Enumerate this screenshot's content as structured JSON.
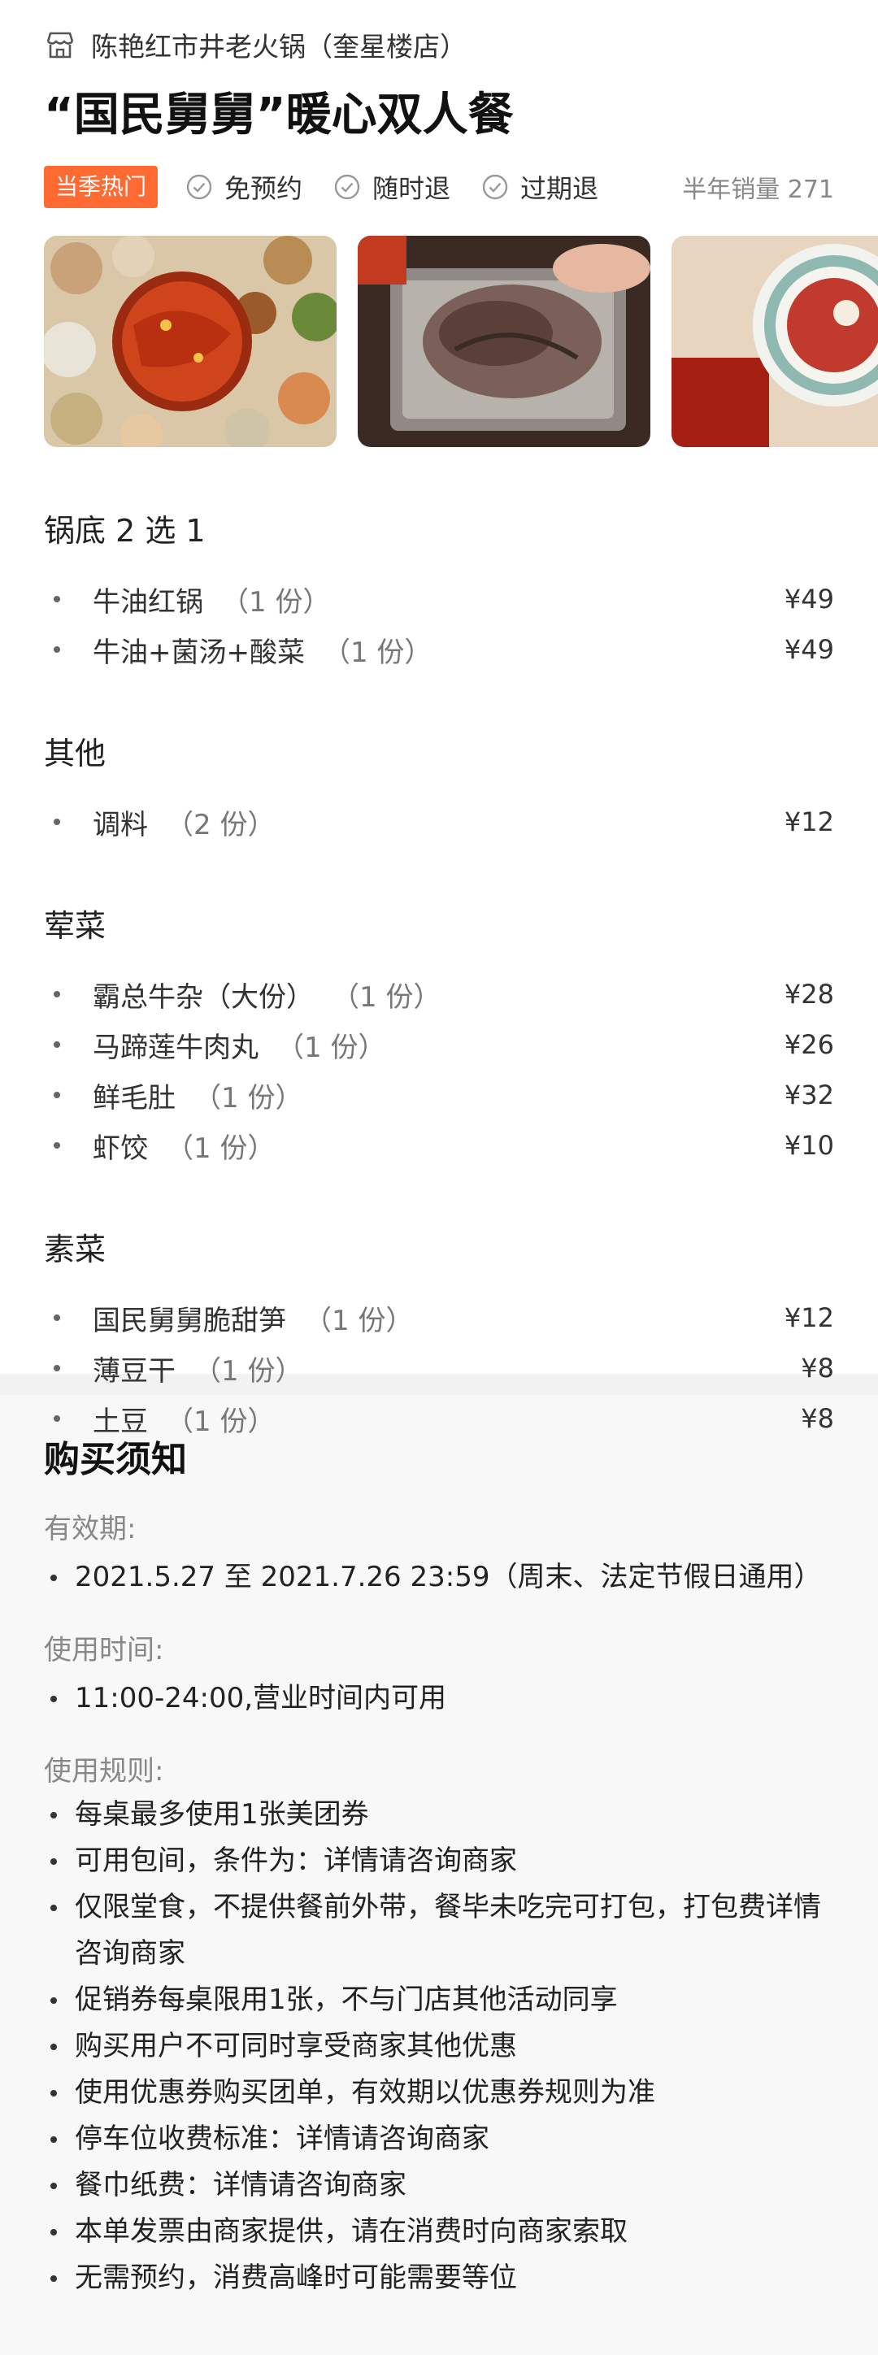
{
  "store": {
    "name": "陈艳红市井老火锅（奎星楼店）",
    "icon": "store-icon"
  },
  "deal": {
    "title": "“国民舅舅”暖心双人餐",
    "hot_tag": "当季热门",
    "features": [
      "免预约",
      "随时退",
      "过期退"
    ],
    "sales": "半年销量 271"
  },
  "menu": {
    "sections": [
      {
        "title": "锅底 2 选 1",
        "items": [
          {
            "name": "牛油红锅",
            "qty": "（1 份）",
            "price": "¥49"
          },
          {
            "name": "牛油+菌汤+酸菜",
            "qty": "（1 份）",
            "price": "¥49"
          }
        ]
      },
      {
        "title": "其他",
        "items": [
          {
            "name": "调料",
            "qty": "（2 份）",
            "price": "¥12"
          }
        ]
      },
      {
        "title": "荤菜",
        "items": [
          {
            "name": "霸总牛杂（大份）",
            "qty": "（1 份）",
            "price": "¥28"
          },
          {
            "name": "马蹄莲牛肉丸",
            "qty": "（1 份）",
            "price": "¥26"
          },
          {
            "name": "鲜毛肚",
            "qty": "（1 份）",
            "price": "¥32"
          },
          {
            "name": "虾饺",
            "qty": "（1 份）",
            "price": "¥10"
          }
        ]
      },
      {
        "title": "素菜",
        "items": [
          {
            "name": "国民舅舅脆甜笋",
            "qty": "（1 份）",
            "price": "¥12"
          },
          {
            "name": "薄豆干",
            "qty": "（1 份）",
            "price": "¥8"
          },
          {
            "name": "土豆",
            "qty": "（1 份）",
            "price": "¥8"
          }
        ]
      }
    ]
  },
  "notice": {
    "title": "购买须知",
    "validity_label": "有效期:",
    "validity": "2021.5.27 至 2021.7.26 23:59（周末、法定节假日通用）",
    "time_label": "使用时间:",
    "time": "11:00-24:00,营业时间内可用",
    "rules_label": "使用规则:",
    "rules": [
      "每桌最多使用1张美团券",
      "可用包间，条件为：详情请咨询商家",
      "仅限堂食，不提供餐前外带，餐毕未吃完可打包，打包费详情咨询商家",
      "促销券每桌限用1张，不与门店其他活动同享",
      "购买用户不可同时享受商家其他优惠",
      "使用优惠券购买团单，有效期以优惠券规则为准",
      "停车位收费标准：详情请咨询商家",
      "餐巾纸费：详情请咨询商家",
      "本单发票由商家提供，请在消费时向商家索取",
      "无需预约，消费高峰时可能需要等位"
    ]
  },
  "colors": {
    "accent": "#ff6a33",
    "text": "#222222",
    "muted": "#888888",
    "notice_bg": "#f8f8f8"
  }
}
